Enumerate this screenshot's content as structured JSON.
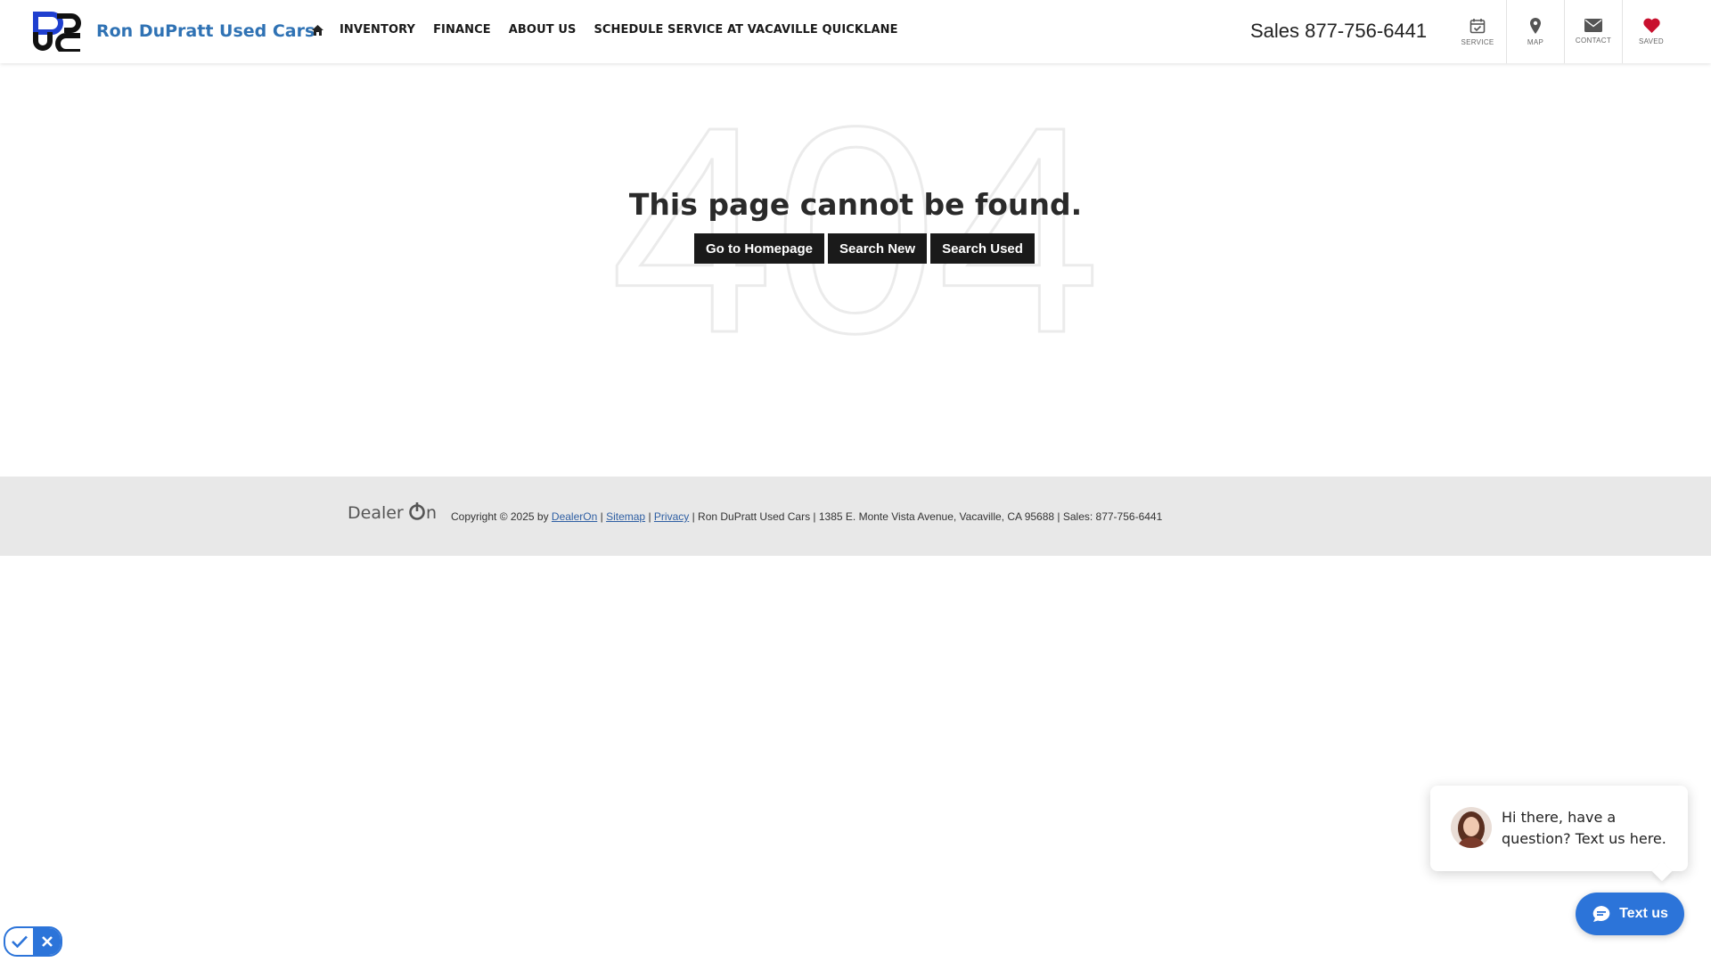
{
  "header": {
    "dealer_name": "Ron DuPratt Used Cars",
    "nav": [
      "INVENTORY",
      "FINANCE",
      "ABOUT US",
      "SCHEDULE SERVICE AT VACAVILLE QUICKLANE"
    ],
    "sales_phone": "Sales 877-756-6441",
    "utility": [
      {
        "label": "SERVICE",
        "icon": "calendar-check-icon"
      },
      {
        "label": "MAP",
        "icon": "map-pin-icon"
      },
      {
        "label": "CONTACT",
        "icon": "envelope-icon"
      },
      {
        "label": "SAVED",
        "icon": "heart-icon"
      }
    ]
  },
  "main": {
    "big_number": "404",
    "message": "This page cannot be found.",
    "buttons": [
      "Go to Homepage",
      "Search New",
      "Search Used"
    ]
  },
  "footer": {
    "copyright": "Copyright © 2025 by",
    "dealeron_link": "DealerOn",
    "sitemap_link": "Sitemap",
    "privacy_link": "Privacy",
    "info": "Ron DuPratt Used Cars | 1385 E. Monte Vista Avenue, Vacaville, CA 95688 | Sales: 877-756-6441"
  },
  "chat": {
    "message": "Hi there, have a question? Text us here.",
    "button_label": "Text us"
  },
  "colors": {
    "brand_blue": "#2f72b4",
    "accent_blue": "#2c74d9",
    "button_dark": "#1a1a1a",
    "footer_bg": "#e8e8e8",
    "heart_red": "#c8102e"
  }
}
